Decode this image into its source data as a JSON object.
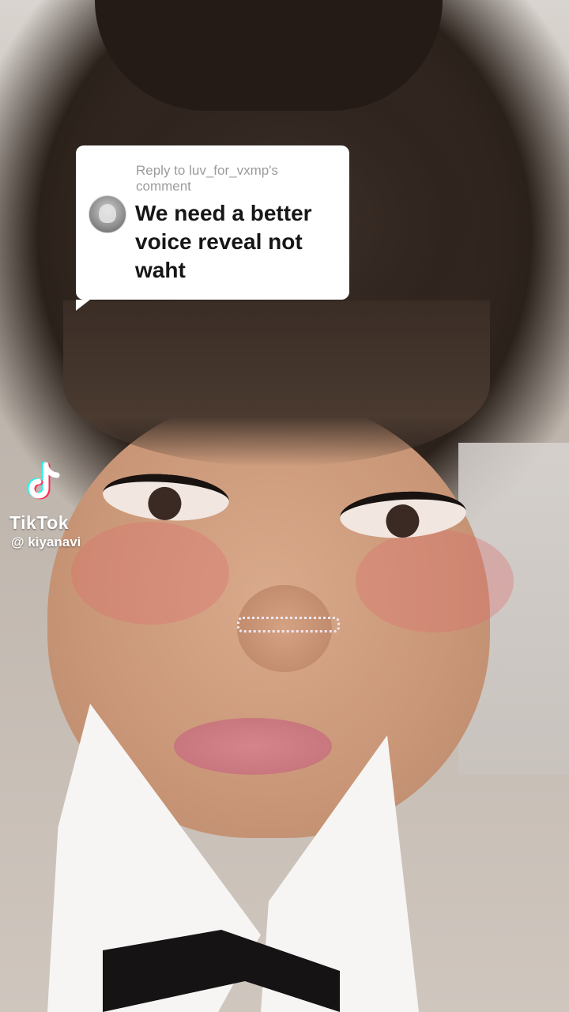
{
  "reply": {
    "header": "Reply to luv_for_vxmp's comment",
    "text": "We need a better voice reveal not waht"
  },
  "watermark": {
    "brand": "TikTok",
    "handle": "@ kiyanavi"
  },
  "colors": {
    "bubble_bg": "#ffffff",
    "header_text": "#9b9b9b",
    "body_text": "#161616",
    "tiktok_cyan": "#25f4ee",
    "tiktok_red": "#fe2c55"
  },
  "icons": {
    "logo": "tiktok-logo-icon",
    "avatar": "commenter-avatar"
  }
}
